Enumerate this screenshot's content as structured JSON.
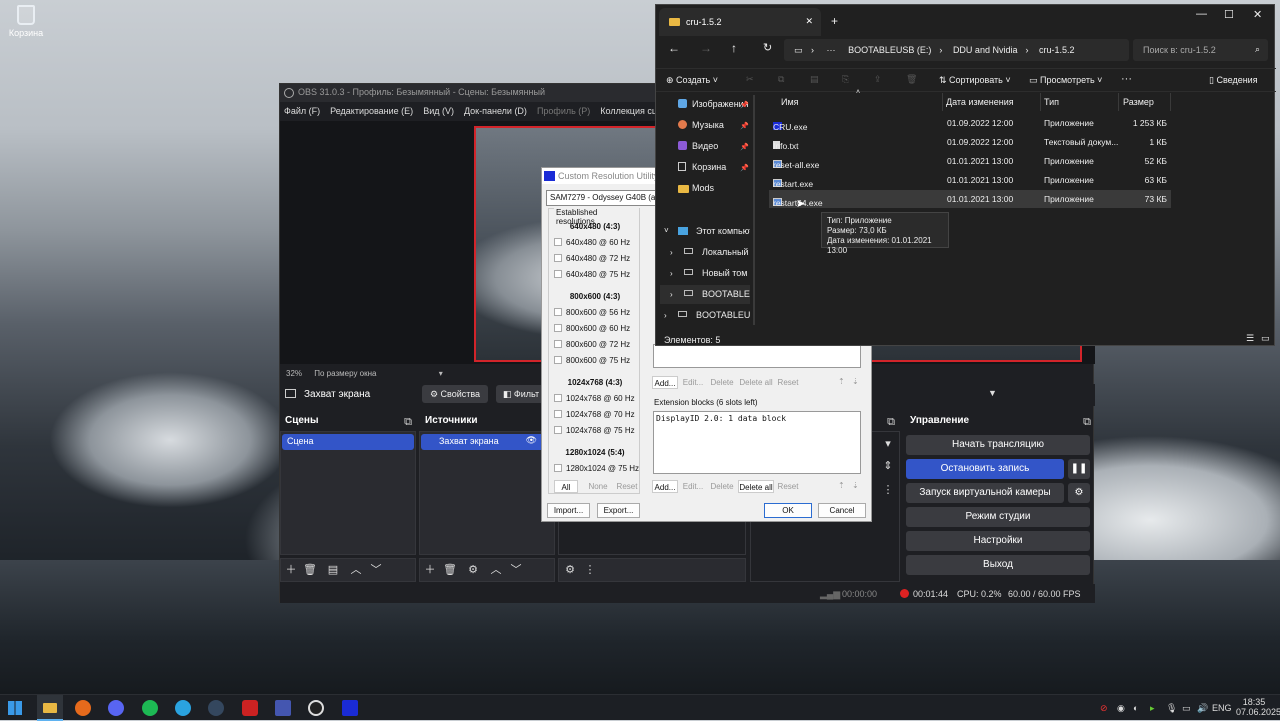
{
  "desktop": {
    "recycle_bin_label": "Корзина"
  },
  "obs": {
    "title": "OBS 31.0.3 - Профиль: Безымянный - Сцены: Безымянный",
    "menu": [
      "Файл (F)",
      "Редактирование (E)",
      "Вид (V)",
      "Док-панели (D)",
      "Профиль (P)",
      "Коллекция сцен"
    ],
    "zoom": "32%",
    "zoom_mode": "По размеру окна",
    "source_name": "Захват экрана",
    "properties_label": "Свойства",
    "filters_label": "Фильт",
    "scenes_title": "Сцены",
    "scene_item": "Сцена",
    "sources_title": "Источники",
    "source_item": "Захват экрана",
    "controls_title": "Управление",
    "controls": {
      "start_stream": "Начать трансляцию",
      "stop_record": "Остановить запись",
      "virtual_cam": "Запуск виртуальной камеры",
      "studio_mode": "Режим студии",
      "settings": "Настройки",
      "exit": "Выход"
    },
    "status": {
      "stream_time": "00:00:00",
      "rec_time": "00:01:44",
      "cpu": "CPU: 0.2%",
      "fps": "60.00 / 60.00 FPS"
    }
  },
  "cru": {
    "title": "Custom Resolution Utility 1",
    "monitor": "SAM7279 - Odyssey G40B (active)",
    "established_label": "Established resolutions",
    "groups": [
      {
        "header": "640x480 (4:3)",
        "items": [
          "640x480 @ 60 Hz",
          "640x480 @ 72 Hz",
          "640x480 @ 75 Hz"
        ]
      },
      {
        "header": "800x600 (4:3)",
        "items": [
          "800x600 @ 56 Hz",
          "800x600 @ 60 Hz",
          "800x600 @ 72 Hz",
          "800x600 @ 75 Hz"
        ]
      },
      {
        "header": "1024x768 (4:3)",
        "items": [
          "1024x768 @ 60 Hz",
          "1024x768 @ 70 Hz",
          "1024x768 @ 75 Hz"
        ]
      },
      {
        "header": "1280x1024 (5:4)",
        "items": [
          "1280x1024 @ 75 Hz"
        ]
      }
    ],
    "sel_buttons": [
      "All",
      "None",
      "Reset"
    ],
    "edit_buttons": [
      "Add...",
      "Edit...",
      "Delete",
      "Delete all",
      "Reset"
    ],
    "edit_buttons2": [
      "Add...",
      "Edit...",
      "Delete",
      "Delete all",
      "Reset"
    ],
    "extension_label": "Extension blocks (6 slots left)",
    "extension_item": "DisplayID 2.0: 1 data block",
    "import": "Import...",
    "export": "Export...",
    "ok": "OK",
    "cancel": "Cancel"
  },
  "explorer": {
    "tab": "cru-1.5.2",
    "crumbs": [
      "BOOTABLEUSB (E:)",
      "DDU and Nvidia",
      "cru-1.5.2"
    ],
    "search_placeholder": "Поиск в: cru-1.5.2",
    "toolbar": {
      "create": "Создать",
      "sort": "Сортировать",
      "view": "Просмотреть",
      "details": "Сведения"
    },
    "nav": [
      "Изображения",
      "Музыка",
      "Видео",
      "Корзина",
      "Mods",
      "Этот компьютер",
      "Локальный диск",
      "Новый том (D",
      "BOOTABLEUSB",
      "BOOTABLEUSB ("
    ],
    "columns": [
      "Имя",
      "Дата изменения",
      "Тип",
      "Размер"
    ],
    "files": [
      {
        "name": "CRU.exe",
        "date": "01.09.2022 12:00",
        "type": "Приложение",
        "size": "1 253 КБ"
      },
      {
        "name": "Info.txt",
        "date": "01.09.2022 12:00",
        "type": "Текстовый докум...",
        "size": "1 КБ"
      },
      {
        "name": "reset-all.exe",
        "date": "01.01.2021 13:00",
        "type": "Приложение",
        "size": "52 КБ"
      },
      {
        "name": "restart.exe",
        "date": "01.01.2021 13:00",
        "type": "Приложение",
        "size": "63 КБ"
      },
      {
        "name": "restart64.exe",
        "date": "01.01.2021 13:00",
        "type": "Приложение",
        "size": "73 КБ"
      }
    ],
    "tooltip": {
      "type": "Тип: Приложение",
      "size": "Размер: 73,0 КБ",
      "date": "Дата изменения: 01.01.2021 13:00"
    },
    "item_count": "Элементов: 5"
  },
  "taskbar": {
    "lang": "ENG",
    "time": "18:35",
    "date": "07.06.2025"
  }
}
